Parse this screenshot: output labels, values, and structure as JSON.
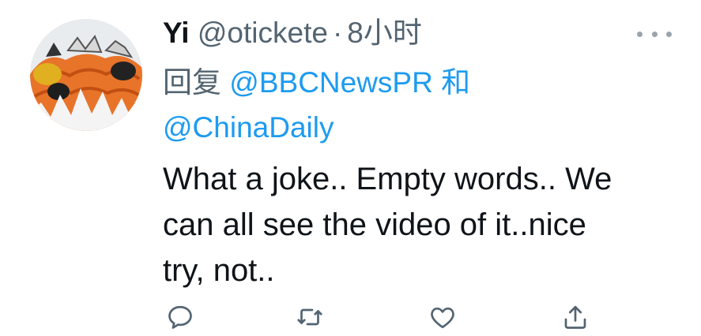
{
  "tweet": {
    "author": {
      "display_name": "Yi",
      "handle": "@otickete",
      "separator": "·",
      "timestamp": "8小时"
    },
    "reply": {
      "prefix": "回复",
      "mention_1": "@BBCNewsPR",
      "conjunction": "和",
      "mention_2": "@ChinaDaily"
    },
    "text": "What a joke.. Empty words.. We\ncan all see the video of it..nice\ntry, not..",
    "actions": [
      {
        "name": "reply-icon"
      },
      {
        "name": "retweet-icon"
      },
      {
        "name": "like-icon"
      },
      {
        "name": "share-icon"
      }
    ]
  },
  "colors": {
    "accent": "#1d9bf0",
    "secondary_text": "#536471",
    "primary_text": "#0f1419",
    "icon": "#536471"
  }
}
